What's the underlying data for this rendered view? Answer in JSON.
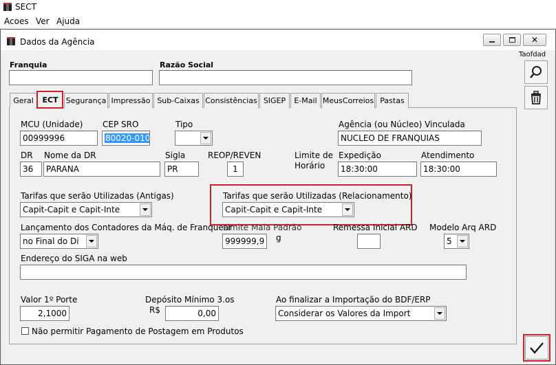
{
  "app": {
    "title": "SECT"
  },
  "menu": {
    "items": [
      "Acoes",
      "Ver",
      "Ajuda"
    ]
  },
  "dialog": {
    "title": "Dados da Agência",
    "franquia_label": "Franquia",
    "franquia_value": "",
    "razao_label": "Razão Social",
    "razao_value": "",
    "side_caption": "Taofdad"
  },
  "tabs": [
    "Geral",
    "ECT",
    "Segurança",
    "Impressão",
    "Sub-Caixas",
    "Consistências",
    "SIGEP",
    "E-Mail",
    "MeusCorreios",
    "Pastas"
  ],
  "active_tab": "ECT",
  "form": {
    "mcu_label": "MCU (Unidade)",
    "mcu_value": "00999996",
    "cep_label": "CEP SRO",
    "cep_value": "80020-010",
    "tipo_label": "Tipo",
    "tipo_value": "",
    "agencia_label": "Agência (ou Núcleo) Vinculada",
    "agencia_value": "NUCLEO DE FRANQUIAS",
    "dr_label": "DR",
    "dr_value": "36",
    "nome_dr_label": "Nome da DR",
    "nome_dr_value": "PARANA",
    "sigla_label": "Sigla",
    "sigla_value": "PR",
    "reop_label": "REOP/REVEN",
    "reop_value": "1",
    "limite_label_1": "Limite de",
    "limite_label_2": "Horário",
    "expedicao_label": "Expedição",
    "expedicao_value": "18:30:00",
    "atendimento_label": "Atendimento",
    "atendimento_value": "18:30:00",
    "tarifas_antigas_label": "Tarifas que serão Utilizadas (Antigas)",
    "tarifas_antigas_value": "Capit-Capit e Capit-Inte",
    "tarifas_rel_label": "Tarifas que serão Utilizadas (Relacionamento)",
    "tarifas_rel_value": "Capit-Capit e Capit-Inte",
    "lancamento_label": "Lançamento dos Contadores da Máq. de Franquear",
    "lancamento_value": "no Final do Di",
    "limite_mala_label": "Limite Mala Padrão",
    "limite_mala_value": "999999,9",
    "limite_mala_unit": "g",
    "remessa_label": "Remessa Inicial ARD",
    "remessa_value": "",
    "modelo_label": "Modelo Arq ARD",
    "modelo_value": "5",
    "siga_label": "Endereço do SIGA na web",
    "siga_value": "",
    "valor_porte_label": "Valor 1º Porte",
    "valor_porte_value": "2,1000",
    "deposito_label_1": "Depósito Mínimo 3.os",
    "deposito_label_2": "R$",
    "deposito_value": "0,00",
    "finalizar_label": "Ao finalizar a Importação do BDF/ERP",
    "finalizar_value": "Considerar os Valores da Import",
    "nao_permitir_label": "Não permitir Pagamento de Postagem em Produtos",
    "nao_permitir_checked": false
  },
  "colors": {
    "highlight_red": "#d0202a",
    "selection_blue": "#3399ff"
  }
}
